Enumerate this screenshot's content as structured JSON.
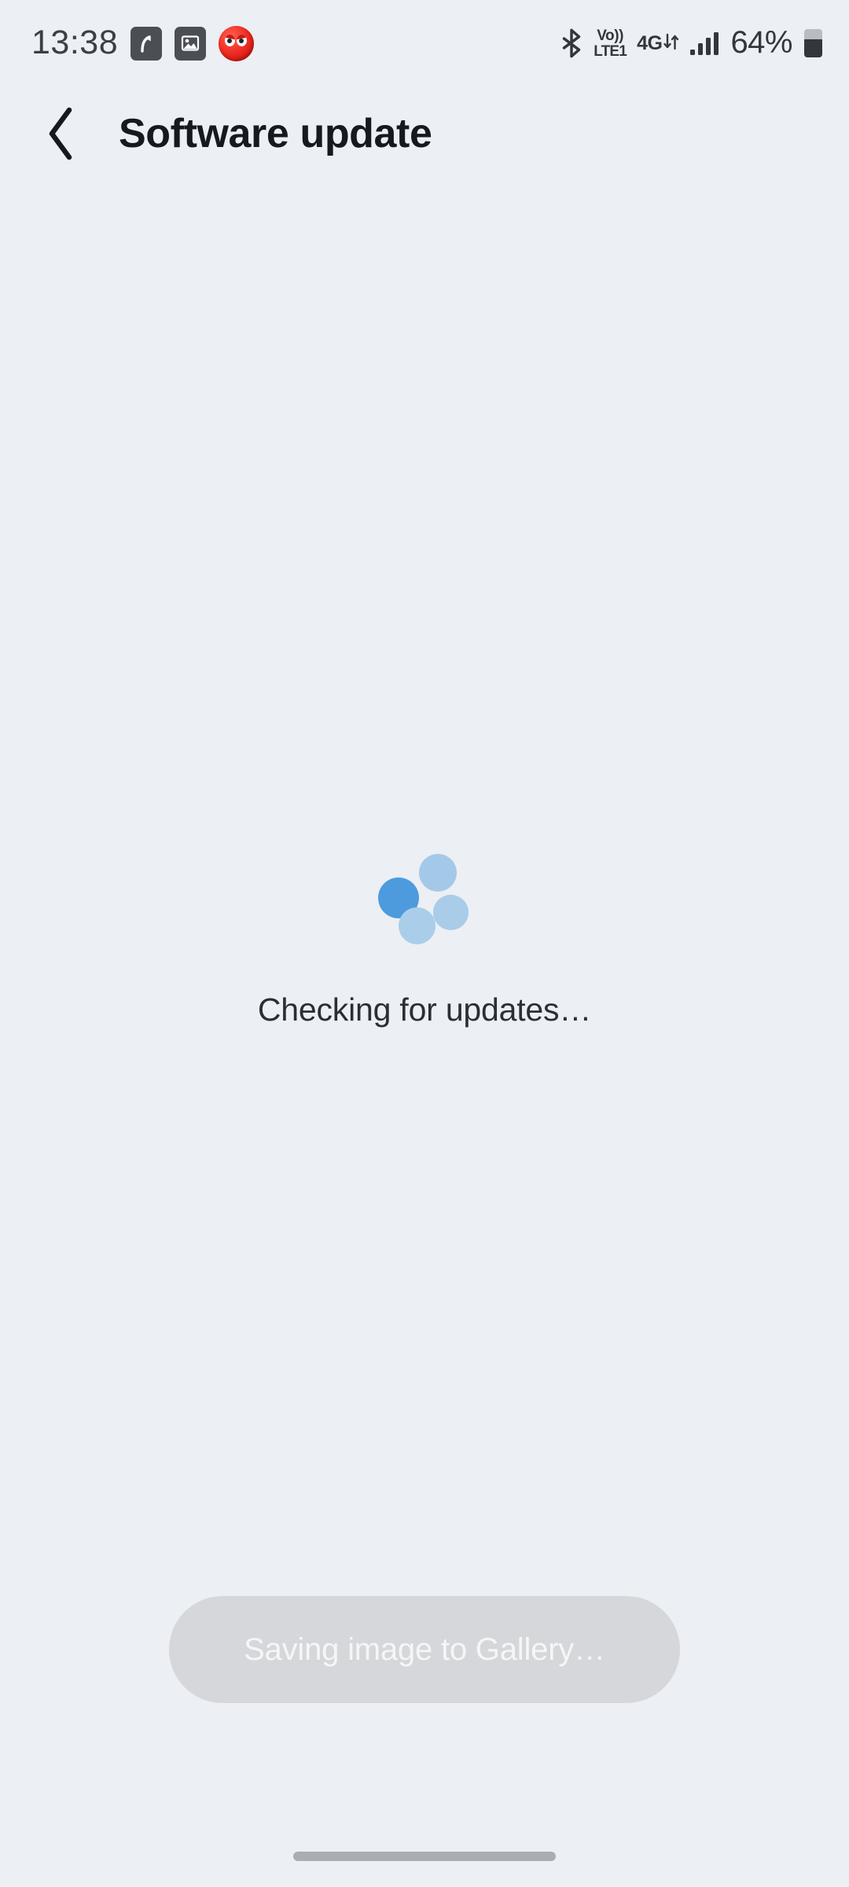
{
  "theme": {
    "background": "#eceff4",
    "text_primary": "#16191d",
    "spinner_accent": "#4d9bdd",
    "spinner_light": "#a7cbe8",
    "toast_background": "#d5d7da"
  },
  "status_bar": {
    "clock": "13:38",
    "notification_icons": [
      {
        "name": "call-forward-icon",
        "glyph": "share-arrow"
      },
      {
        "name": "gallery-image-icon",
        "glyph": "photo"
      },
      {
        "name": "red-ball-app-icon",
        "glyph": "red-ball-face"
      }
    ],
    "system_icons": {
      "bluetooth": "bluetooth-icon",
      "volte_top": "Vo))",
      "volte_bottom": "LTE1",
      "network_type": "4G",
      "data_activity": "down-up-arrows-icon",
      "signal": "signal-bars-icon",
      "battery_percent": "64%",
      "battery_icon": "battery-icon",
      "battery_level": 64
    }
  },
  "header": {
    "back_label": "back-chevron",
    "title": "Software update"
  },
  "main": {
    "spinner_label": "loading-spinner",
    "status_text": "Checking for updates…"
  },
  "toast": {
    "message": "Saving image to Gallery…"
  },
  "nav_bar": {
    "home_indicator": "home-gesture-bar"
  }
}
